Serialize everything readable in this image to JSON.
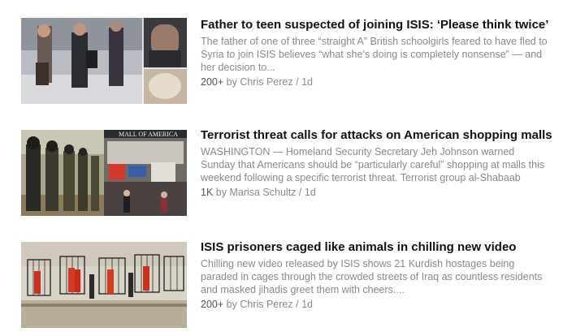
{
  "stories": [
    {
      "headline": "Father to teen suspected of joining ISIS: ‘Please think twice’",
      "excerpt": "The father of one of three “straight A” British schoolgirls feared to have fled to Syria to join ISIS believes “what she’s doing is completely nonsense” — and her decision to...",
      "count": "200+",
      "byline": "by Chris Perez",
      "sep": "/",
      "age": "1d",
      "thumbnail_icon": "airport-cctv-photo"
    },
    {
      "headline": "Terrorist threat calls for attacks on American shopping malls",
      "excerpt": "WASHINGTON — Homeland Security Secretary Jeh Johnson warned Sunday that Americans should be “particularly careful” shopping at malls this weekend following a specific terrorist threat. Terrorist group al-Shabaab released a",
      "count": "1K",
      "byline": "by Marisa Schultz",
      "sep": "/",
      "age": "1d",
      "thumbnail_icon": "militants-and-mall-photo",
      "thumbnail_sign": "MALL OF AMERICA"
    },
    {
      "headline": "ISIS prisoners caged like animals in chilling new video",
      "excerpt": "Chilling new video released by ISIS shows 21 Kurdish hostages being paraded in cages through the crowded streets of Iraq as countless residents and masked jihadis greet them with cheers....",
      "count": "200+",
      "byline": "by Chris Perez",
      "sep": "/",
      "age": "1d",
      "thumbnail_icon": "caged-prisoners-photo"
    }
  ]
}
